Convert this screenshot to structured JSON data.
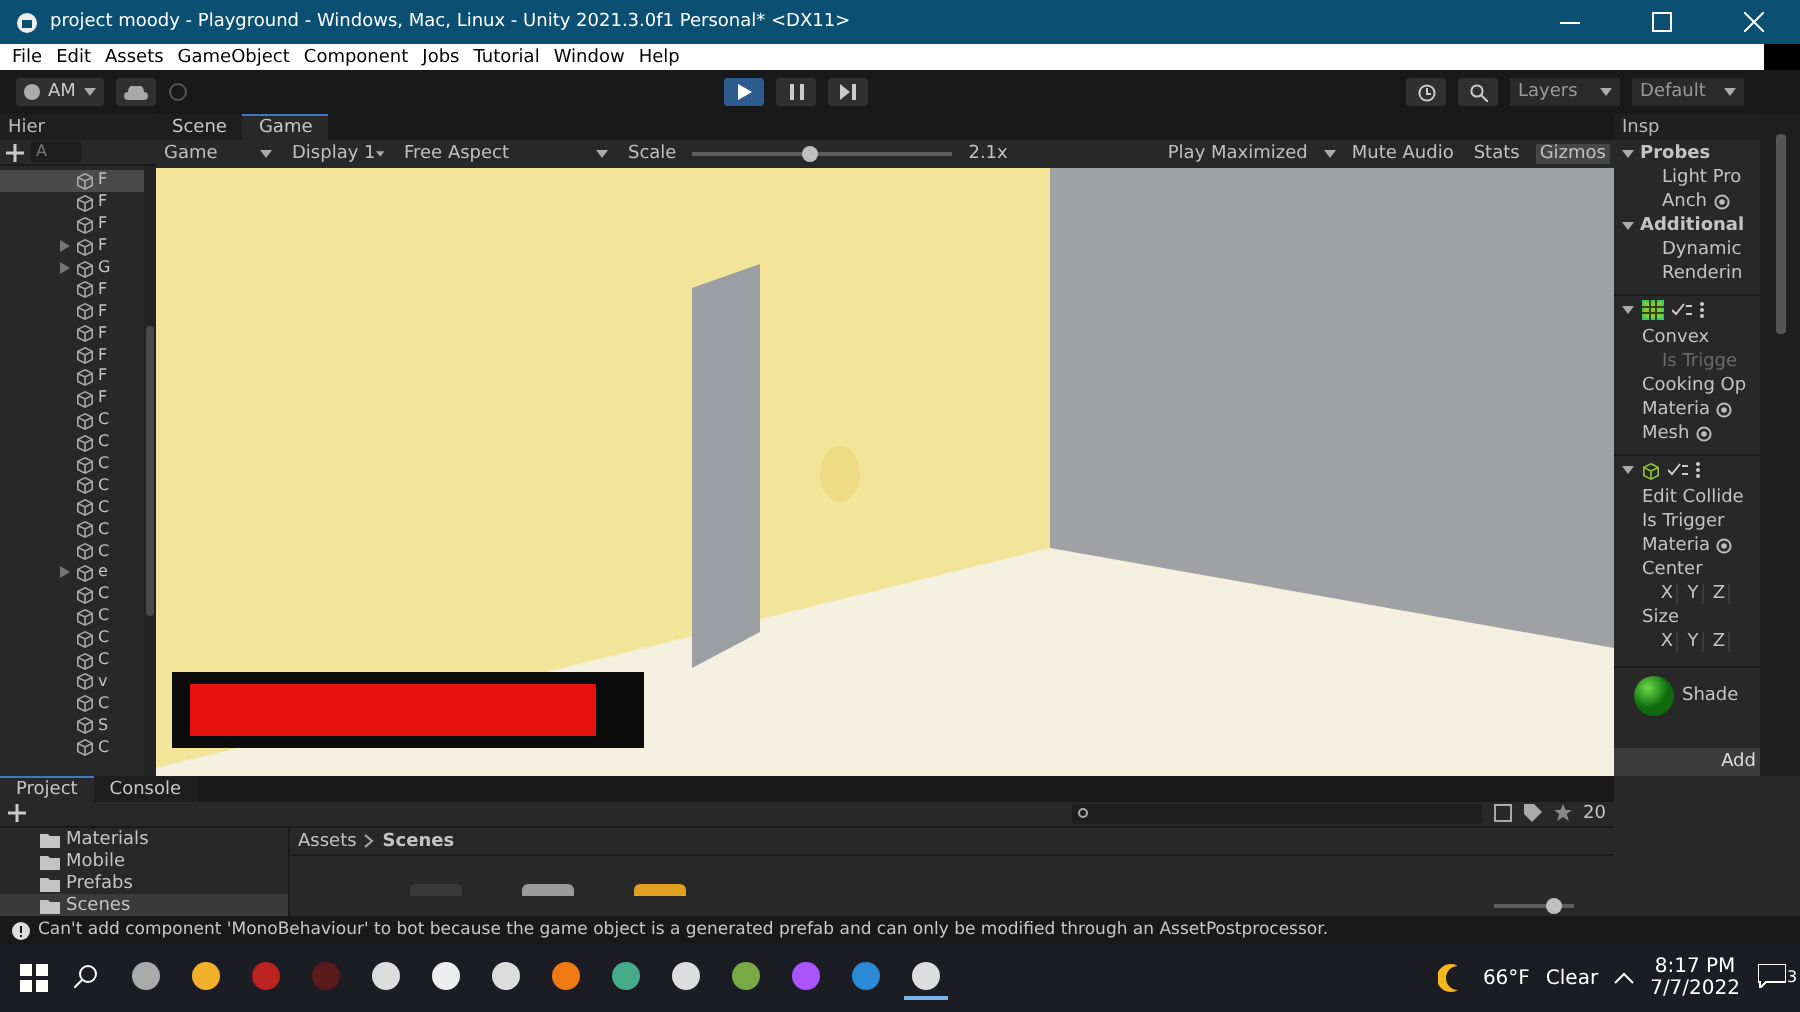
{
  "window": {
    "title": "project moody - Playground - Windows, Mac, Linux - Unity 2021.3.0f1 Personal* <DX11>"
  },
  "menu": [
    "File",
    "Edit",
    "Assets",
    "GameObject",
    "Component",
    "Jobs",
    "Tutorial",
    "Window",
    "Help"
  ],
  "toolbar": {
    "account": "AM",
    "layers": "Layers",
    "layout": "Default"
  },
  "hierarchy": {
    "title": "Hier",
    "search": "A",
    "rows": [
      {
        "label": "F",
        "selected": true,
        "expandable": false
      },
      {
        "label": "F",
        "selected": false,
        "expandable": false
      },
      {
        "label": "F",
        "selected": false,
        "expandable": false
      },
      {
        "label": "F",
        "selected": false,
        "expandable": true
      },
      {
        "label": "G",
        "selected": false,
        "expandable": true
      },
      {
        "label": "F",
        "selected": false,
        "expandable": false
      },
      {
        "label": "F",
        "selected": false,
        "expandable": false
      },
      {
        "label": "F",
        "selected": false,
        "expandable": false
      },
      {
        "label": "F",
        "selected": false,
        "expandable": false
      },
      {
        "label": "F",
        "selected": false,
        "expandable": false
      },
      {
        "label": "F",
        "selected": false,
        "expandable": false
      },
      {
        "label": "C",
        "selected": false,
        "expandable": false
      },
      {
        "label": "C",
        "selected": false,
        "expandable": false
      },
      {
        "label": "C",
        "selected": false,
        "expandable": false
      },
      {
        "label": "C",
        "selected": false,
        "expandable": false
      },
      {
        "label": "C",
        "selected": false,
        "expandable": false
      },
      {
        "label": "C",
        "selected": false,
        "expandable": false
      },
      {
        "label": "C",
        "selected": false,
        "expandable": false
      },
      {
        "label": "e",
        "selected": false,
        "expandable": true
      },
      {
        "label": "C",
        "selected": false,
        "expandable": false
      },
      {
        "label": "C",
        "selected": false,
        "expandable": false
      },
      {
        "label": "C",
        "selected": false,
        "expandable": false
      },
      {
        "label": "C",
        "selected": false,
        "expandable": false
      },
      {
        "label": "v",
        "selected": false,
        "expandable": false
      },
      {
        "label": "C",
        "selected": false,
        "expandable": false
      },
      {
        "label": "S",
        "selected": false,
        "expandable": false
      },
      {
        "label": "C",
        "selected": false,
        "expandable": false
      }
    ]
  },
  "view_tabs": [
    {
      "label": "Scene",
      "selected": false
    },
    {
      "label": "Game",
      "selected": true
    }
  ],
  "game_bar": {
    "mode": "Game",
    "display": "Display 1",
    "aspect": "Free Aspect",
    "scale_label": "Scale",
    "scale": {
      "level": 0.45
    },
    "scale_value": "2.1x",
    "play": "Play Maximized",
    "mute": "Mute Audio",
    "stats": "Stats",
    "gizmos": "Gizmos"
  },
  "health_bar": {
    "level": 0.93
  },
  "inspector": {
    "title": "Insp",
    "items": [
      {
        "kind": "header",
        "label": "Probes"
      },
      {
        "kind": "field",
        "label": "Light Pro",
        "disabled": false,
        "target": false
      },
      {
        "kind": "field",
        "label": "Anch",
        "disabled": false,
        "target": true
      },
      {
        "kind": "header",
        "label": "Additional"
      },
      {
        "kind": "field",
        "label": "Dynamic",
        "disabled": false,
        "target": false
      },
      {
        "kind": "field",
        "label": "Renderin",
        "disabled": false,
        "target": false
      },
      {
        "kind": "component"
      },
      {
        "kind": "label",
        "label": "Convex",
        "disabled": false,
        "target": false
      },
      {
        "kind": "field",
        "label": "Is Trigge",
        "disabled": true,
        "target": false
      },
      {
        "kind": "label",
        "label": "Cooking Op",
        "disabled": false,
        "target": false
      },
      {
        "kind": "label",
        "label": "Materia",
        "disabled": false,
        "target": true
      },
      {
        "kind": "label",
        "label": "Mesh",
        "disabled": false,
        "target": true
      },
      {
        "kind": "component"
      },
      {
        "kind": "label",
        "label": "Edit Collide",
        "disabled": false,
        "target": false
      },
      {
        "kind": "label",
        "label": "Is Trigger",
        "disabled": false,
        "target": false
      },
      {
        "kind": "label",
        "label": "Materia",
        "disabled": false,
        "target": true
      },
      {
        "kind": "label",
        "label": "Center",
        "disabled": false,
        "target": false
      },
      {
        "kind": "xyz",
        "axes": [
          "X",
          "Y",
          "Z"
        ]
      },
      {
        "kind": "label",
        "label": "Size",
        "disabled": false,
        "target": false
      },
      {
        "kind": "xyz",
        "axes": [
          "X",
          "Y",
          "Z"
        ]
      },
      {
        "kind": "material",
        "label": "Shade"
      }
    ],
    "add_button": "Add"
  },
  "bottom_tabs": [
    {
      "label": "Project",
      "selected": true
    },
    {
      "label": "Console",
      "selected": false
    }
  ],
  "project": {
    "count": "20",
    "folders": [
      {
        "label": "Materials",
        "selected": false
      },
      {
        "label": "Mobile",
        "selected": false
      },
      {
        "label": "Prefabs",
        "selected": false
      },
      {
        "label": "Scenes",
        "selected": true
      }
    ],
    "breadcrumb": [
      "Assets",
      "Scenes"
    ],
    "zoom": {
      "level": 0.75
    }
  },
  "status_bar": {
    "message": "Can't add component 'MonoBehaviour' to bot because the game object is a generated prefab and can only be modified through an AssetPostprocessor."
  },
  "taskbar": {
    "weather": "66°F",
    "condition": "Clear",
    "time": "8:17 PM",
    "date": "7/7/2022",
    "notifications": "3"
  }
}
